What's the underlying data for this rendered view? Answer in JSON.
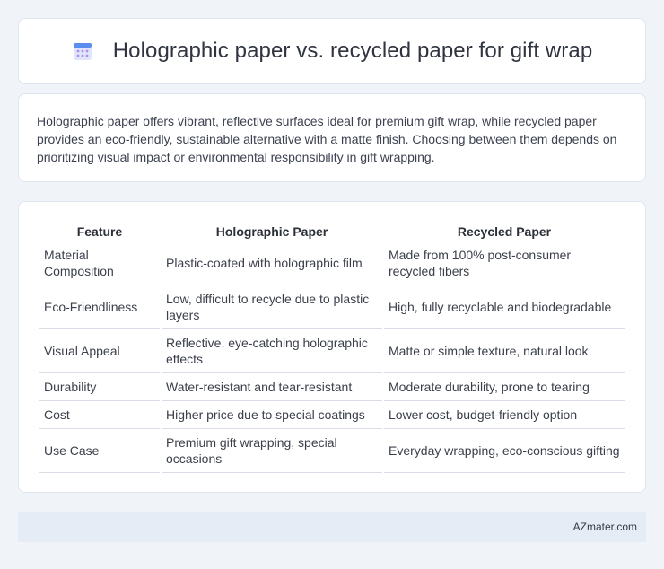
{
  "header": {
    "icon": "calendar-grid-icon",
    "title": "Holographic paper vs. recycled paper for gift wrap"
  },
  "summary": {
    "text": "Holographic paper offers vibrant, reflective surfaces ideal for premium gift wrap, while recycled paper provides an eco-friendly, sustainable alternative with a matte finish. Choosing between them depends on prioritizing visual impact or environmental responsibility in gift wrapping."
  },
  "table": {
    "headers": [
      "Feature",
      "Holographic Paper",
      "Recycled Paper"
    ],
    "rows": [
      [
        "Material Composition",
        "Plastic-coated with holographic film",
        "Made from 100% post-consumer recycled fibers"
      ],
      [
        "Eco-Friendliness",
        "Low, difficult to recycle due to plastic layers",
        "High, fully recyclable and biodegradable"
      ],
      [
        "Visual Appeal",
        "Reflective, eye-catching holographic effects",
        "Matte or simple texture, natural look"
      ],
      [
        "Durability",
        "Water-resistant and tear-resistant",
        "Moderate durability, prone to tearing"
      ],
      [
        "Cost",
        "Higher price due to special coatings",
        "Lower cost, budget-friendly option"
      ],
      [
        "Use Case",
        "Premium gift wrapping, special occasions",
        "Everyday wrapping, eco-conscious gifting"
      ]
    ]
  },
  "footer": {
    "brand": "AZmater.com"
  },
  "colors": {
    "background": "#f0f3f8",
    "card": "#ffffff",
    "footer": "#e6ecf5",
    "icon_top": "#5b8def",
    "icon_body": "#c9d6f5"
  }
}
